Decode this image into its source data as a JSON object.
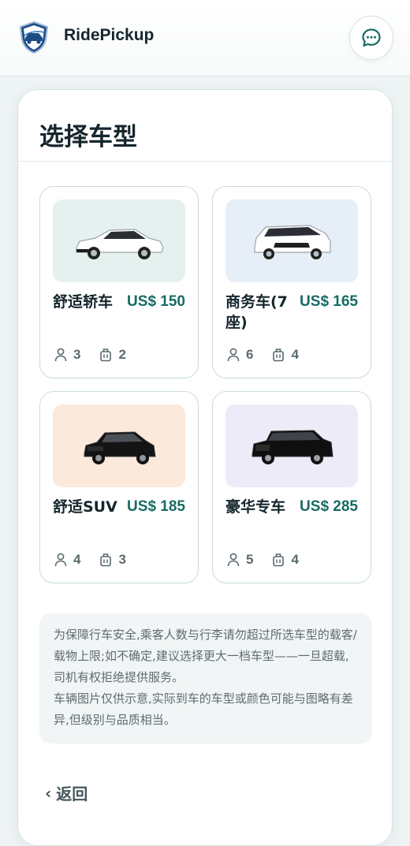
{
  "header": {
    "brand": "RidePickup",
    "logo_icon": "shield-car-logo",
    "chat_icon": "chat-bubble-icon"
  },
  "page": {
    "title": "选择车型"
  },
  "vehicles": [
    {
      "name": "舒适轿车",
      "price": "US$ 150",
      "passengers": "3",
      "luggage": "2",
      "thumb_bg": "#e5f1ee",
      "car_color": "#ffffff"
    },
    {
      "name": "商务车(7座)",
      "price": "US$ 165",
      "passengers": "6",
      "luggage": "4",
      "thumb_bg": "#e6eef7",
      "car_color": "#ffffff"
    },
    {
      "name": "舒适SUV",
      "price": "US$ 185",
      "passengers": "4",
      "luggage": "3",
      "thumb_bg": "#fbe9dc",
      "car_color": "#111111"
    },
    {
      "name": "豪华专车",
      "price": "US$ 285",
      "passengers": "5",
      "luggage": "4",
      "thumb_bg": "#ecebf7",
      "car_color": "#111111"
    }
  ],
  "notice": {
    "line1": "为保障行车安全,乘客人数与行李请勿超过所选车型的载客/载物上限;如不确定,建议选择更大一档车型——一旦超载,司机有权拒绝提供服务。",
    "line2": "车辆图片仅供示意,实际到车的车型或颜色可能与图略有差异,但级别与品质相当。"
  },
  "back": {
    "label": "返回",
    "icon": "chevron-left-icon"
  },
  "colors": {
    "accent": "#176b63",
    "title": "#15262c"
  }
}
